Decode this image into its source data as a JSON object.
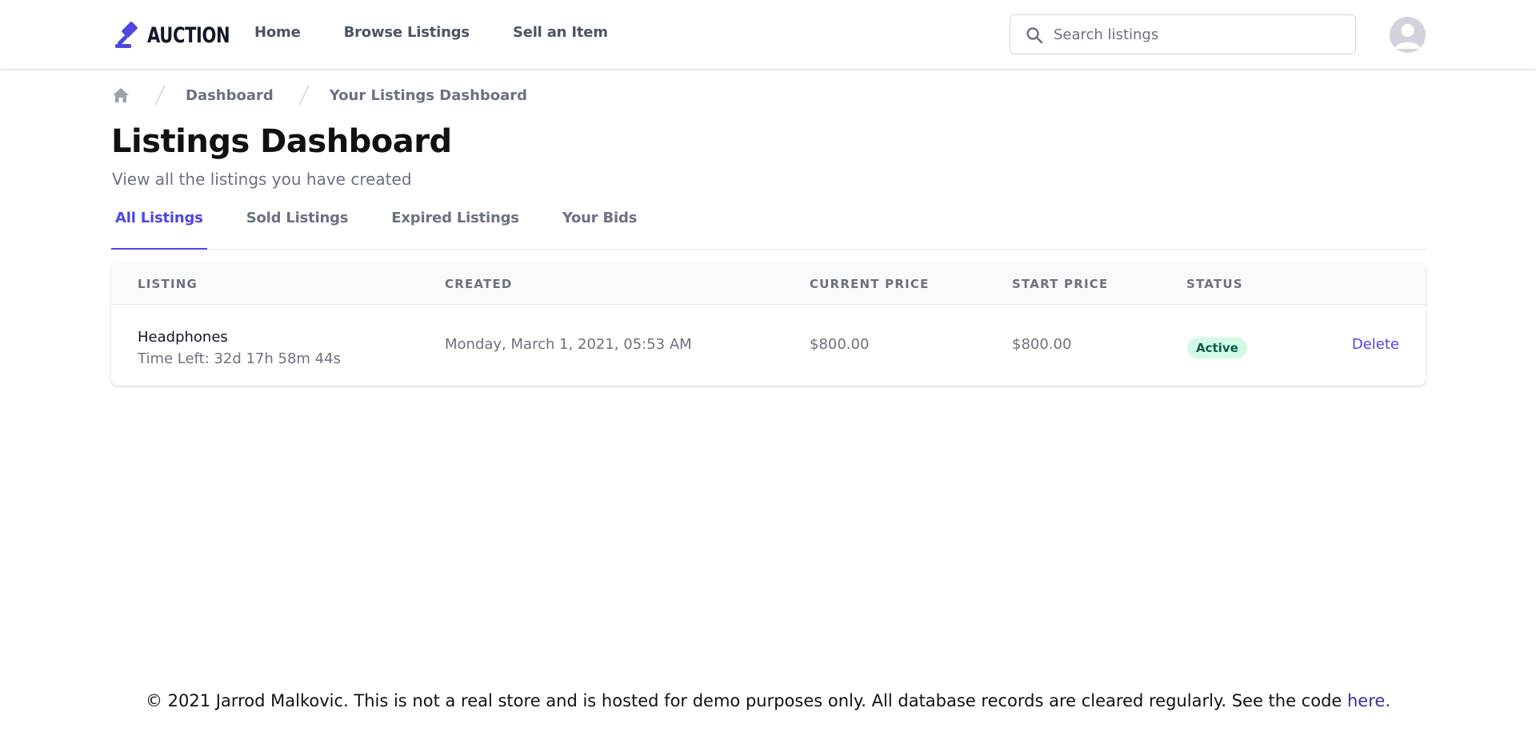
{
  "brand": {
    "name": "AUCTION",
    "accent": "#4f46e5"
  },
  "nav": {
    "items": [
      {
        "label": "Home"
      },
      {
        "label": "Browse Listings"
      },
      {
        "label": "Sell an Item"
      }
    ]
  },
  "search": {
    "placeholder": "Search listings",
    "icon": "search-icon"
  },
  "user": {
    "avatar_icon": "user-avatar-icon"
  },
  "breadcrumb": {
    "home_icon": "home-icon",
    "items": [
      "Dashboard",
      "Your Listings Dashboard"
    ]
  },
  "page": {
    "title": "Listings Dashboard",
    "subtitle": "View all the listings you have created"
  },
  "tabs": [
    {
      "label": "All Listings",
      "active": true
    },
    {
      "label": "Sold Listings",
      "active": false
    },
    {
      "label": "Expired Listings",
      "active": false
    },
    {
      "label": "Your Bids",
      "active": false
    }
  ],
  "table": {
    "headers": [
      "LISTING",
      "CREATED",
      "CURRENT PRICE",
      "START PRICE",
      "STATUS"
    ],
    "rows": [
      {
        "name": "Headphones",
        "time_left": "Time Left: 32d 17h 58m 44s",
        "created": "Monday, March 1, 2021, 05:53 AM",
        "current_price": "$800.00",
        "start_price": "$800.00",
        "status": "Active",
        "action": "Delete"
      }
    ]
  },
  "footer": {
    "text": "© 2021 Jarrod Malkovic. This is not a real store and is hosted for demo purposes only. All database records are cleared regularly. See the code ",
    "link_label": "here."
  }
}
